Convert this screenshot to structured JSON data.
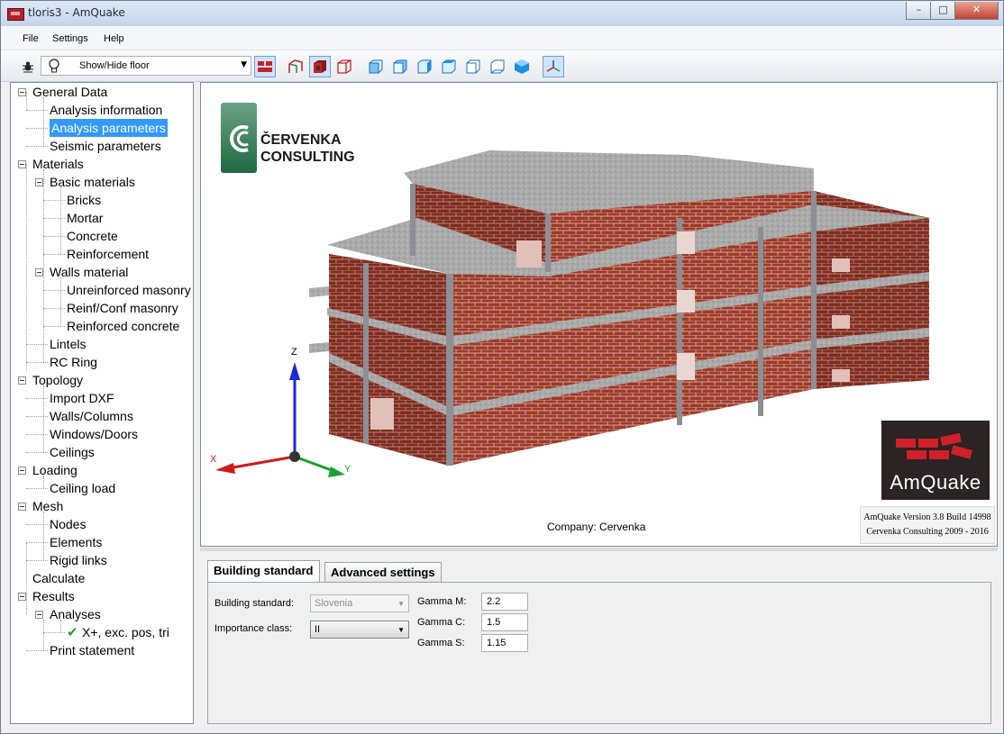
{
  "window": {
    "title": "tloris3 - AmQuake",
    "controls": [
      "–",
      "□",
      "✕"
    ]
  },
  "menu": [
    "File",
    "Settings",
    "Help"
  ],
  "toolbar": {
    "floor_combo": "Show/Hide floor",
    "icons": [
      "bug-icon",
      "bulb-icon",
      "wall-view-icon",
      "wireframe-icon",
      "solid-view-icon",
      "transparent-view-icon",
      "front-view-icon",
      "back-view-icon",
      "left-view-icon",
      "right-view-icon",
      "top-view-icon",
      "bottom-view-icon",
      "iso-view-icon",
      "axes-icon"
    ]
  },
  "tree": [
    {
      "label": "General Data",
      "level": 0,
      "expander": true
    },
    {
      "label": "Analysis information",
      "level": 1
    },
    {
      "label": "Analysis parameters",
      "level": 1,
      "selected": true
    },
    {
      "label": "Seismic parameters",
      "level": 1
    },
    {
      "label": "Materials",
      "level": 0,
      "expander": true
    },
    {
      "label": "Basic materials",
      "level": 1,
      "expander": true
    },
    {
      "label": "Bricks",
      "level": 2
    },
    {
      "label": "Mortar",
      "level": 2
    },
    {
      "label": "Concrete",
      "level": 2
    },
    {
      "label": "Reinforcement",
      "level": 2
    },
    {
      "label": "Walls material",
      "level": 1,
      "expander": true
    },
    {
      "label": "Unreinforced masonry",
      "level": 2
    },
    {
      "label": "Reinf/Conf masonry",
      "level": 2
    },
    {
      "label": "Reinforced concrete",
      "level": 2
    },
    {
      "label": "Lintels",
      "level": 1
    },
    {
      "label": "RC Ring",
      "level": 1
    },
    {
      "label": "Topology",
      "level": 0,
      "expander": true
    },
    {
      "label": "Import DXF",
      "level": 1
    },
    {
      "label": "Walls/Columns",
      "level": 1
    },
    {
      "label": "Windows/Doors",
      "level": 1
    },
    {
      "label": "Ceilings",
      "level": 1
    },
    {
      "label": "Loading",
      "level": 0,
      "expander": true
    },
    {
      "label": "Ceiling load",
      "level": 1
    },
    {
      "label": "Mesh",
      "level": 0,
      "expander": true
    },
    {
      "label": "Nodes",
      "level": 1
    },
    {
      "label": "Elements",
      "level": 1
    },
    {
      "label": "Rigid links",
      "level": 1
    },
    {
      "label": "Calculate",
      "level": 0
    },
    {
      "label": "Results",
      "level": 0,
      "expander": true
    },
    {
      "label": "Analyses",
      "level": 1,
      "expander": true
    },
    {
      "label": "X+, exc. pos, tri",
      "level": 2,
      "check": true
    },
    {
      "label": "Print statement",
      "level": 1
    }
  ],
  "viewport": {
    "logo_text_line1": "ČERVENKA",
    "logo_text_line2": "CONSULTING",
    "company": "Company: Cervenka",
    "amquake_logo": "AmQuake",
    "version_line1": "AmQuake Version 3.8 Build 14998",
    "version_line2": "Cervenka Consulting 2009 - 2016",
    "axes": {
      "z": "Z",
      "x": "X",
      "y": "Y"
    },
    "colors": {
      "brick": "#9c3b2a",
      "slab": "#a8a8a8",
      "column": "#8c8f94"
    }
  },
  "settings": {
    "tabs": [
      "Building standard",
      "Advanced settings"
    ],
    "active_tab": 0,
    "building_standard_label": "Building standard:",
    "building_standard_value": "Slovenia",
    "importance_class_label": "Importance class:",
    "importance_class_value": "II",
    "gamma_m_label": "Gamma M:",
    "gamma_m_value": "2.2",
    "gamma_c_label": "Gamma C:",
    "gamma_c_value": "1.5",
    "gamma_s_label": "Gamma S:",
    "gamma_s_value": "1.15"
  }
}
